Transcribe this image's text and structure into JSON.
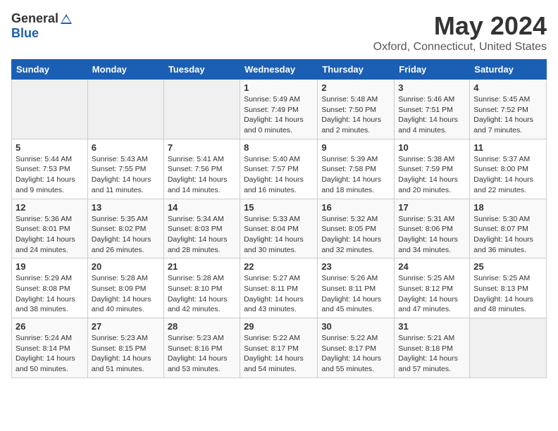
{
  "logo": {
    "general": "General",
    "blue": "Blue"
  },
  "title": "May 2024",
  "location": "Oxford, Connecticut, United States",
  "days_of_week": [
    "Sunday",
    "Monday",
    "Tuesday",
    "Wednesday",
    "Thursday",
    "Friday",
    "Saturday"
  ],
  "weeks": [
    [
      {
        "day": "",
        "content": ""
      },
      {
        "day": "",
        "content": ""
      },
      {
        "day": "",
        "content": ""
      },
      {
        "day": "1",
        "content": "Sunrise: 5:49 AM\nSunset: 7:49 PM\nDaylight: 14 hours and 0 minutes."
      },
      {
        "day": "2",
        "content": "Sunrise: 5:48 AM\nSunset: 7:50 PM\nDaylight: 14 hours and 2 minutes."
      },
      {
        "day": "3",
        "content": "Sunrise: 5:46 AM\nSunset: 7:51 PM\nDaylight: 14 hours and 4 minutes."
      },
      {
        "day": "4",
        "content": "Sunrise: 5:45 AM\nSunset: 7:52 PM\nDaylight: 14 hours and 7 minutes."
      }
    ],
    [
      {
        "day": "5",
        "content": "Sunrise: 5:44 AM\nSunset: 7:53 PM\nDaylight: 14 hours and 9 minutes."
      },
      {
        "day": "6",
        "content": "Sunrise: 5:43 AM\nSunset: 7:55 PM\nDaylight: 14 hours and 11 minutes."
      },
      {
        "day": "7",
        "content": "Sunrise: 5:41 AM\nSunset: 7:56 PM\nDaylight: 14 hours and 14 minutes."
      },
      {
        "day": "8",
        "content": "Sunrise: 5:40 AM\nSunset: 7:57 PM\nDaylight: 14 hours and 16 minutes."
      },
      {
        "day": "9",
        "content": "Sunrise: 5:39 AM\nSunset: 7:58 PM\nDaylight: 14 hours and 18 minutes."
      },
      {
        "day": "10",
        "content": "Sunrise: 5:38 AM\nSunset: 7:59 PM\nDaylight: 14 hours and 20 minutes."
      },
      {
        "day": "11",
        "content": "Sunrise: 5:37 AM\nSunset: 8:00 PM\nDaylight: 14 hours and 22 minutes."
      }
    ],
    [
      {
        "day": "12",
        "content": "Sunrise: 5:36 AM\nSunset: 8:01 PM\nDaylight: 14 hours and 24 minutes."
      },
      {
        "day": "13",
        "content": "Sunrise: 5:35 AM\nSunset: 8:02 PM\nDaylight: 14 hours and 26 minutes."
      },
      {
        "day": "14",
        "content": "Sunrise: 5:34 AM\nSunset: 8:03 PM\nDaylight: 14 hours and 28 minutes."
      },
      {
        "day": "15",
        "content": "Sunrise: 5:33 AM\nSunset: 8:04 PM\nDaylight: 14 hours and 30 minutes."
      },
      {
        "day": "16",
        "content": "Sunrise: 5:32 AM\nSunset: 8:05 PM\nDaylight: 14 hours and 32 minutes."
      },
      {
        "day": "17",
        "content": "Sunrise: 5:31 AM\nSunset: 8:06 PM\nDaylight: 14 hours and 34 minutes."
      },
      {
        "day": "18",
        "content": "Sunrise: 5:30 AM\nSunset: 8:07 PM\nDaylight: 14 hours and 36 minutes."
      }
    ],
    [
      {
        "day": "19",
        "content": "Sunrise: 5:29 AM\nSunset: 8:08 PM\nDaylight: 14 hours and 38 minutes."
      },
      {
        "day": "20",
        "content": "Sunrise: 5:28 AM\nSunset: 8:09 PM\nDaylight: 14 hours and 40 minutes."
      },
      {
        "day": "21",
        "content": "Sunrise: 5:28 AM\nSunset: 8:10 PM\nDaylight: 14 hours and 42 minutes."
      },
      {
        "day": "22",
        "content": "Sunrise: 5:27 AM\nSunset: 8:11 PM\nDaylight: 14 hours and 43 minutes."
      },
      {
        "day": "23",
        "content": "Sunrise: 5:26 AM\nSunset: 8:11 PM\nDaylight: 14 hours and 45 minutes."
      },
      {
        "day": "24",
        "content": "Sunrise: 5:25 AM\nSunset: 8:12 PM\nDaylight: 14 hours and 47 minutes."
      },
      {
        "day": "25",
        "content": "Sunrise: 5:25 AM\nSunset: 8:13 PM\nDaylight: 14 hours and 48 minutes."
      }
    ],
    [
      {
        "day": "26",
        "content": "Sunrise: 5:24 AM\nSunset: 8:14 PM\nDaylight: 14 hours and 50 minutes."
      },
      {
        "day": "27",
        "content": "Sunrise: 5:23 AM\nSunset: 8:15 PM\nDaylight: 14 hours and 51 minutes."
      },
      {
        "day": "28",
        "content": "Sunrise: 5:23 AM\nSunset: 8:16 PM\nDaylight: 14 hours and 53 minutes."
      },
      {
        "day": "29",
        "content": "Sunrise: 5:22 AM\nSunset: 8:17 PM\nDaylight: 14 hours and 54 minutes."
      },
      {
        "day": "30",
        "content": "Sunrise: 5:22 AM\nSunset: 8:17 PM\nDaylight: 14 hours and 55 minutes."
      },
      {
        "day": "31",
        "content": "Sunrise: 5:21 AM\nSunset: 8:18 PM\nDaylight: 14 hours and 57 minutes."
      },
      {
        "day": "",
        "content": ""
      }
    ]
  ]
}
